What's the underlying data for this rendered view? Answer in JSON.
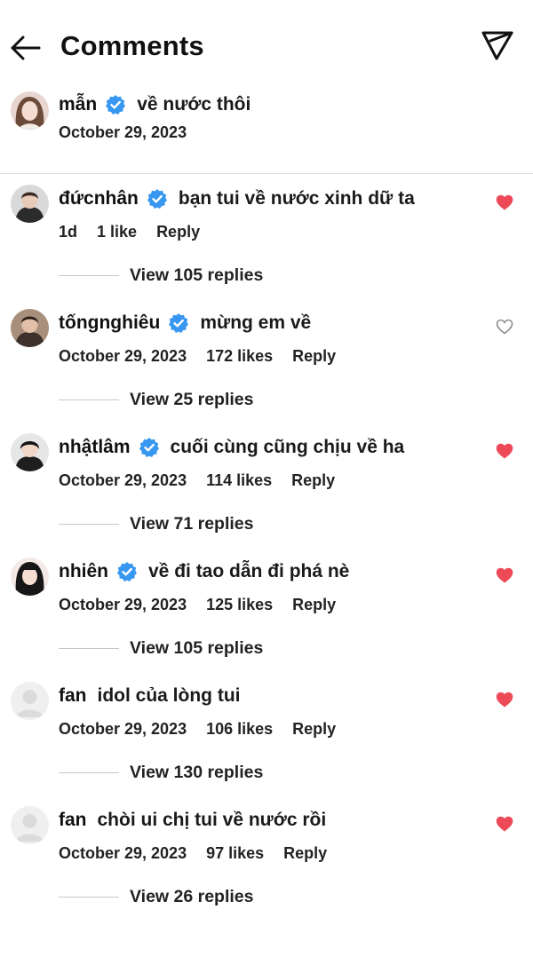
{
  "header": {
    "title": "Comments",
    "back_icon": "arrow-left-icon",
    "send_icon": "paper-plane-icon"
  },
  "caption": {
    "username": "mẫn",
    "text": "về nước thôi",
    "date": "October 29, 2023",
    "verified": true
  },
  "comments": [
    {
      "username": "đứcnhân",
      "verified": true,
      "text": "bạn tui về nước xinh dữ ta",
      "time": "1d",
      "likes": "1 like",
      "reply": "Reply",
      "liked": true,
      "view_replies": "View 105 replies"
    },
    {
      "username": "tốngnghiêu",
      "verified": true,
      "text": "mừng em về",
      "time": "October 29, 2023",
      "likes": "172 likes",
      "reply": "Reply",
      "liked": false,
      "view_replies": "View 25 replies"
    },
    {
      "username": "nhậtlâm",
      "verified": true,
      "text": "cuối cùng cũng chịu về ha",
      "time": "October 29, 2023",
      "likes": "114 likes",
      "reply": "Reply",
      "liked": true,
      "view_replies": "View 71 replies"
    },
    {
      "username": "nhiên",
      "verified": true,
      "text": "về đi tao dẫn đi phá nè",
      "time": "October 29, 2023",
      "likes": "125 likes",
      "reply": "Reply",
      "liked": true,
      "view_replies": "View 105 replies"
    },
    {
      "username": "fan",
      "verified": false,
      "text": "idol của lòng tui",
      "time": "October 29, 2023",
      "likes": "106 likes",
      "reply": "Reply",
      "liked": true,
      "view_replies": "View 130 replies"
    },
    {
      "username": "fan",
      "verified": false,
      "text": "chòi ui chị tui về nước rồi",
      "time": "October 29, 2023",
      "likes": "97 likes",
      "reply": "Reply",
      "liked": true,
      "view_replies": "View 26 replies"
    }
  ],
  "colors": {
    "verified": "#3897f0",
    "heart_liked": "#ed4956",
    "heart_outline": "#8e8e8e"
  }
}
